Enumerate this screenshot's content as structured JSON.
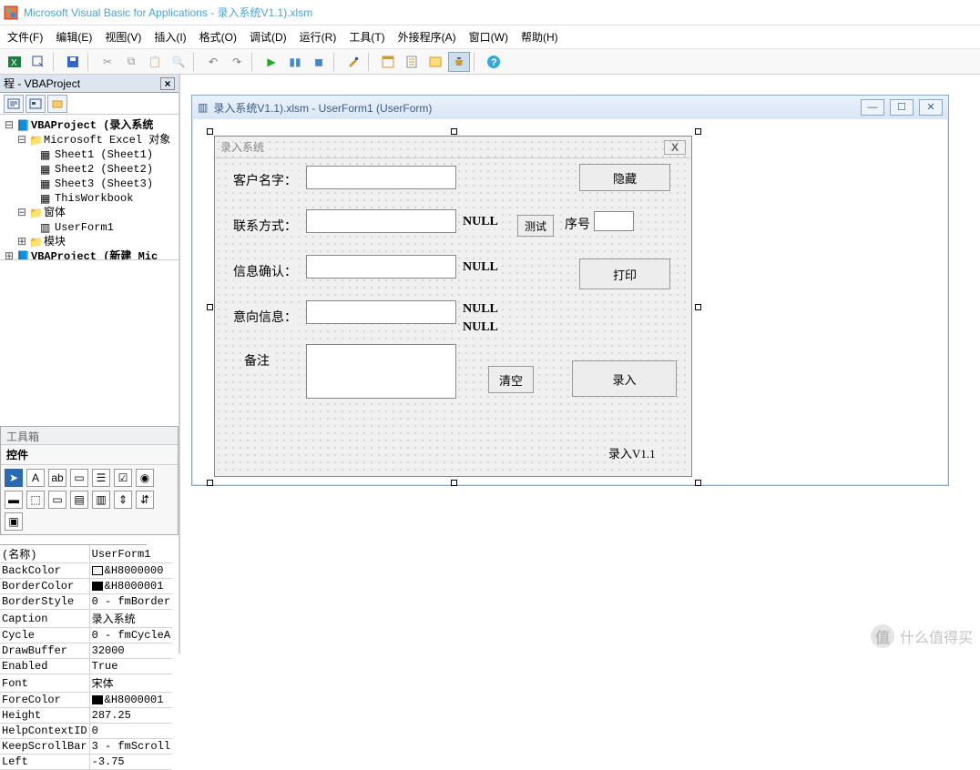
{
  "app": {
    "title": "Microsoft Visual Basic for Applications - 录入系统V1.1).xlsm"
  },
  "menu": {
    "file": "文件(F)",
    "edit": "编辑(E)",
    "view": "视图(V)",
    "insert": "插入(I)",
    "format": "格式(O)",
    "debug": "调试(D)",
    "run": "运行(R)",
    "tools": "工具(T)",
    "addins": "外接程序(A)",
    "window": "窗口(W)",
    "help": "帮助(H)"
  },
  "panels": {
    "project_title": "程 - VBAProject",
    "toolbox_title": "工具箱",
    "toolbox_tab": "控件"
  },
  "tree": {
    "root1": "VBAProject (录入系统",
    "excel_objs": "Microsoft Excel 对象",
    "sheet1": "Sheet1 (Sheet1)",
    "sheet2": "Sheet2 (Sheet2)",
    "sheet3": "Sheet3 (Sheet3)",
    "thiswb": "ThisWorkbook",
    "forms": "窗体",
    "uf1": "UserForm1",
    "modules": "模块",
    "root2": "VBAProject (新建 Mic"
  },
  "mdi": {
    "title": "录入系统V1.1).xlsm - UserForm1 (UserForm)"
  },
  "form": {
    "caption": "录入系统",
    "labels": {
      "name": "客户名字：",
      "contact": "联系方式：",
      "confirm": "信息确认：",
      "intent": "意向信息：",
      "note": "备注",
      "seq": "序号",
      "version": "录入V1.1"
    },
    "null1": "NULL",
    "null2": "NULL",
    "null3": "NULL",
    "null4": "NULL",
    "buttons": {
      "hide": "隐藏",
      "test": "测试",
      "print": "打印",
      "clear": "清空",
      "enter": "录入"
    }
  },
  "props": {
    "header": "(名称)",
    "header_val": "UserForm1",
    "rows": [
      [
        "BackColor",
        "&H8000000"
      ],
      [
        "BorderColor",
        "&H8000001"
      ],
      [
        "BorderStyle",
        "0 - fmBorder"
      ],
      [
        "Caption",
        "录入系统"
      ],
      [
        "Cycle",
        "0 - fmCycleA"
      ],
      [
        "DrawBuffer",
        "32000"
      ],
      [
        "Enabled",
        "True"
      ],
      [
        "Font",
        "宋体"
      ],
      [
        "ForeColor",
        "&H8000001"
      ],
      [
        "Height",
        "287.25"
      ],
      [
        "HelpContextID",
        "0"
      ],
      [
        "KeepScrollBar",
        "3 - fmScroll"
      ],
      [
        "Left",
        "-3.75"
      ]
    ]
  },
  "watermark": {
    "text": "什么值得买",
    "mark": "值"
  }
}
